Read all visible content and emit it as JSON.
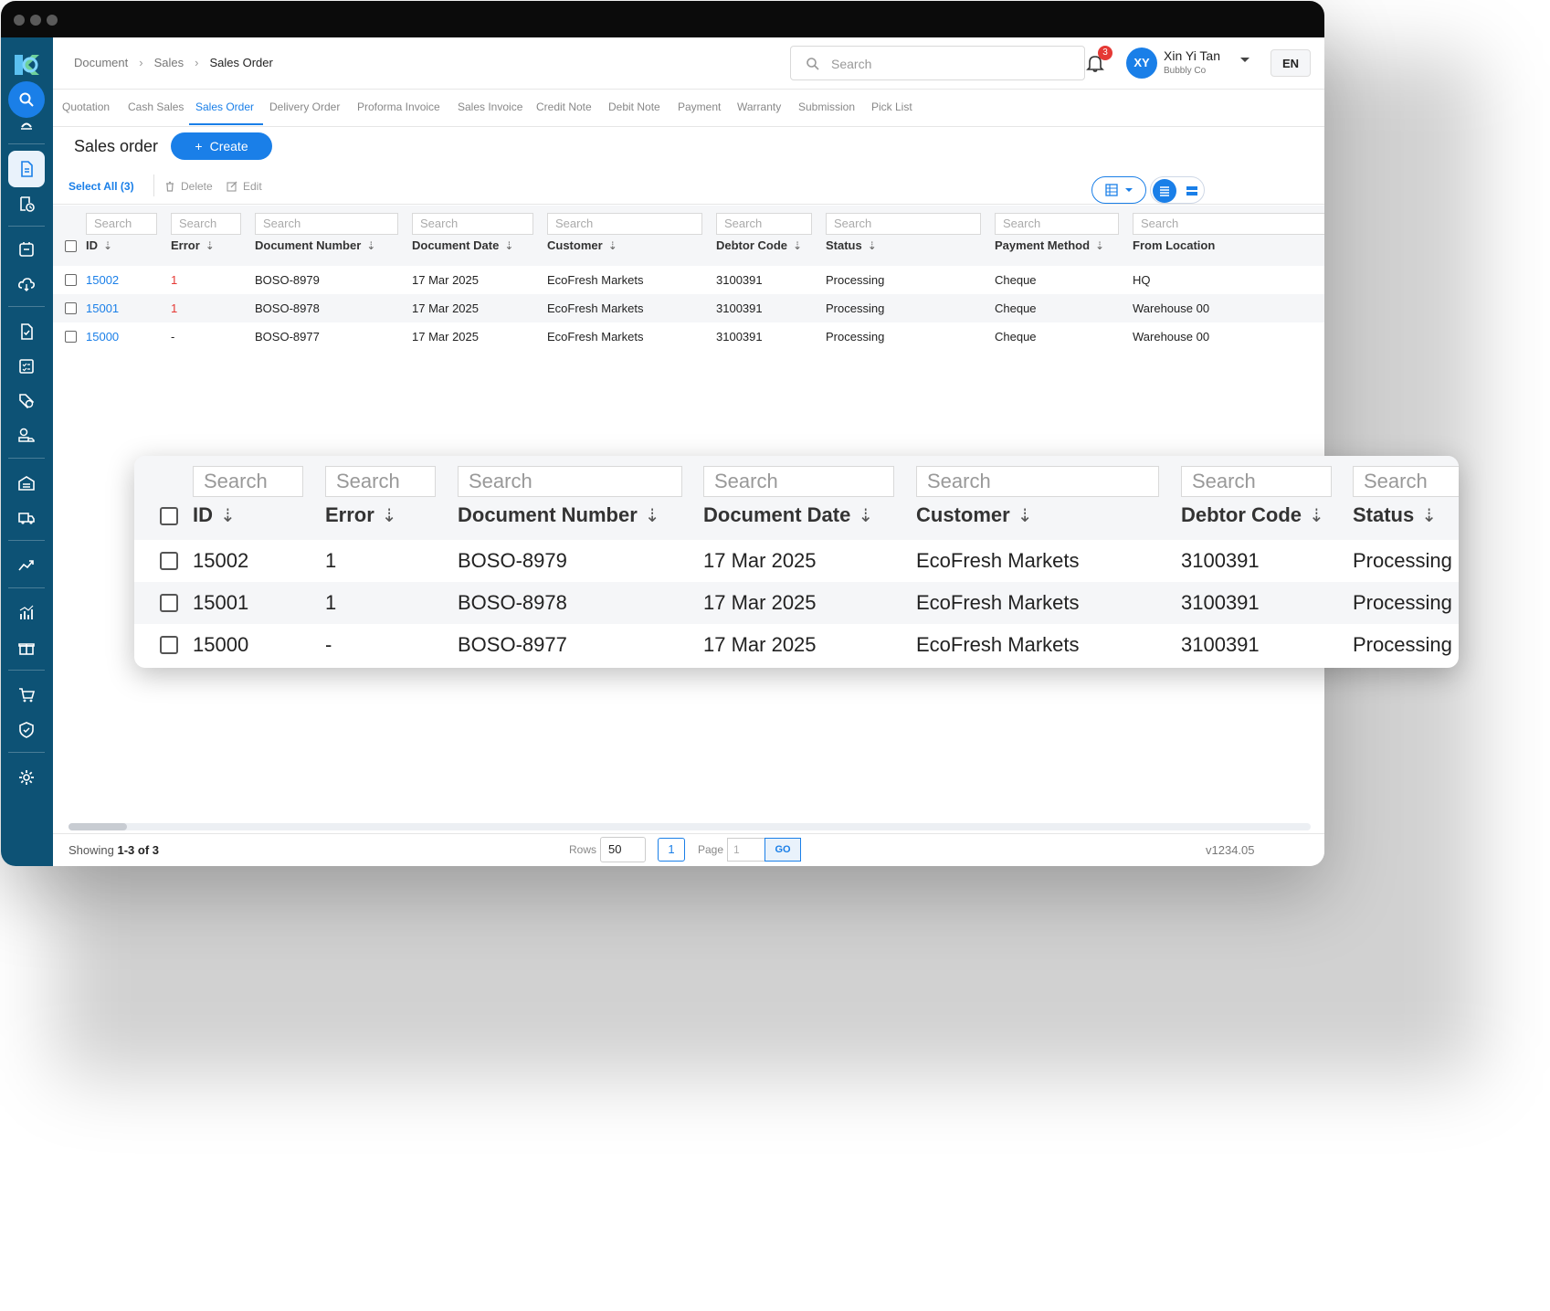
{
  "breadcrumb": [
    "Document",
    "Sales",
    "Sales Order"
  ],
  "header": {
    "search_placeholder": "Search",
    "notification_count": "3",
    "user_initials": "XY",
    "user_name": "Xin Yi Tan",
    "user_company": "Bubbly Co",
    "language": "EN"
  },
  "tabs": [
    "Quotation",
    "Cash Sales",
    "Sales Order",
    "Delivery Order",
    "Proforma Invoice",
    "Sales Invoice",
    "Credit Note",
    "Debit Note",
    "Payment",
    "Warranty",
    "Submission",
    "Pick List"
  ],
  "active_tab": "Sales Order",
  "page": {
    "title": "Sales order",
    "create_label": "Create"
  },
  "toolbar": {
    "select_all": "Select All (3)",
    "delete": "Delete",
    "edit": "Edit"
  },
  "table": {
    "filter_placeholder": "Search",
    "columns": [
      "ID",
      "Error",
      "Document Number",
      "Document Date",
      "Customer",
      "Debtor Code",
      "Status",
      "Payment Method",
      "From Location"
    ],
    "rows": [
      [
        "15002",
        "1",
        "BOSO-8979",
        "17 Mar 2025",
        "EcoFresh Markets",
        "3100391",
        "Processing",
        "Cheque",
        "HQ"
      ],
      [
        "15001",
        "1",
        "BOSO-8978",
        "17 Mar 2025",
        "EcoFresh Markets",
        "3100391",
        "Processing",
        "Cheque",
        "Warehouse 00"
      ],
      [
        "15000",
        "-",
        "BOSO-8977",
        "17 Mar 2025",
        "EcoFresh Markets",
        "3100391",
        "Processing",
        "Cheque",
        "Warehouse 00"
      ]
    ]
  },
  "footer": {
    "showing_prefix": "Showing",
    "showing_range": "1-3 of 3",
    "rows_label": "Rows",
    "rows_value": "50",
    "current_page": "1",
    "page_label": "Page",
    "page_input_placeholder": "1",
    "go_label": "GO",
    "version": "v1234.05"
  },
  "colors": {
    "primary": "#1a7fe8",
    "sidebar": "#0d5275",
    "error": "#e53935",
    "titlebar": "#0b0b0b"
  },
  "sidebar_icons": [
    "logo",
    "search-icon",
    "collapse-icon",
    "document-icon",
    "document-clock-icon",
    "box-icon",
    "cloud-icon",
    "document-check-icon",
    "checklist-icon",
    "tag-clock-icon",
    "truck-money-icon",
    "warehouse-icon",
    "delivery-truck-icon",
    "trending-icon",
    "analytics-icon",
    "gift-icon",
    "cart-icon",
    "shield-check-icon",
    "gear-icon"
  ]
}
